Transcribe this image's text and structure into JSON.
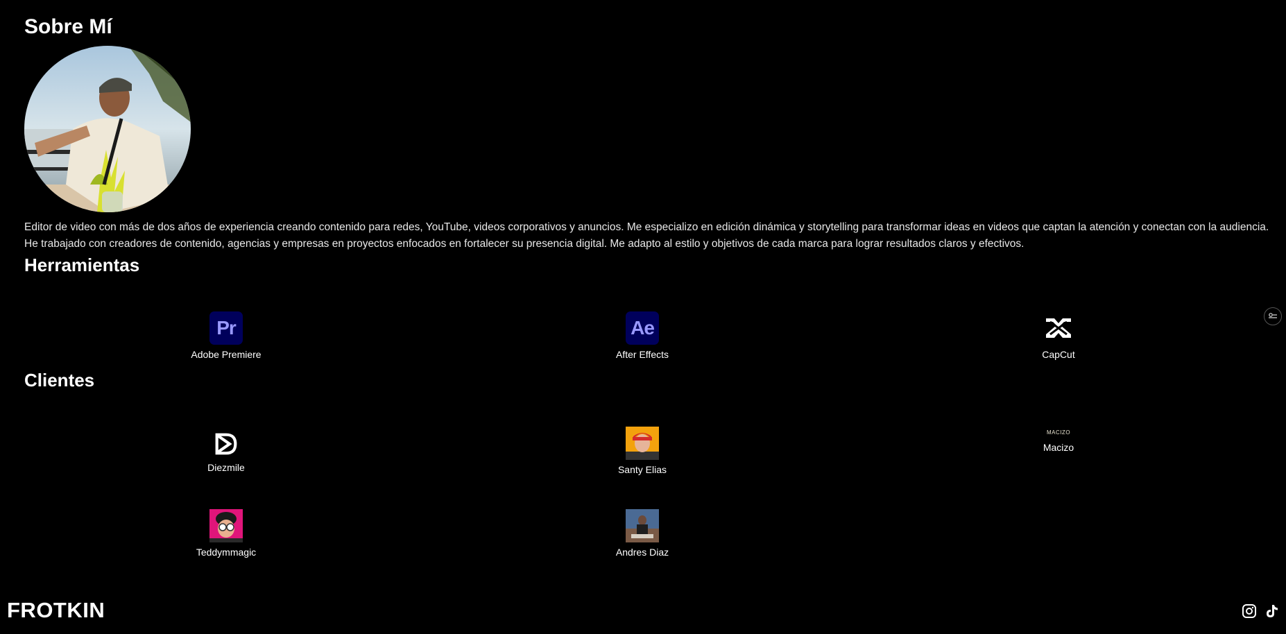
{
  "about": {
    "title": "Sobre Mí",
    "bio_line1": "Editor de video con más de dos años de experiencia creando contenido para redes, YouTube, videos corporativos y anuncios. Me especializo en edición dinámica y storytelling para transformar ideas en videos que captan la atención y conectan con la audiencia.",
    "bio_line2": "He trabajado con creadores de contenido, agencias y empresas en proyectos enfocados en fortalecer su presencia digital. Me adapto al estilo y objetivos de cada marca para lograr resultados claros y efectivos."
  },
  "tools": {
    "title": "Herramientas",
    "items": [
      {
        "label": "Adobe Premiere",
        "icon_text": "Pr",
        "icon": "adobe-premiere-icon"
      },
      {
        "label": "After Effects",
        "icon_text": "Ae",
        "icon": "after-effects-icon"
      },
      {
        "label": "CapCut",
        "icon": "capcut-icon"
      }
    ]
  },
  "clients": {
    "title": "Clientes",
    "items": [
      {
        "label": "Diezmile",
        "icon": "diezmile-logo"
      },
      {
        "label": "Santy Elias",
        "icon": "santy-elias-avatar"
      },
      {
        "label": "Macizo",
        "logo_text": "MACIZO",
        "icon": "macizo-logo"
      },
      {
        "label": "Teddymmagic",
        "icon": "teddymmagic-avatar"
      },
      {
        "label": "Andres Diaz",
        "icon": "andres-diaz-avatar"
      }
    ]
  },
  "footer": {
    "brand": "FROTKIN",
    "social": [
      "instagram-icon",
      "tiktok-icon"
    ]
  },
  "colors": {
    "background": "#000000",
    "text": "#ffffff",
    "adobe_bg": "#00005b",
    "adobe_fg": "#9999ff"
  }
}
